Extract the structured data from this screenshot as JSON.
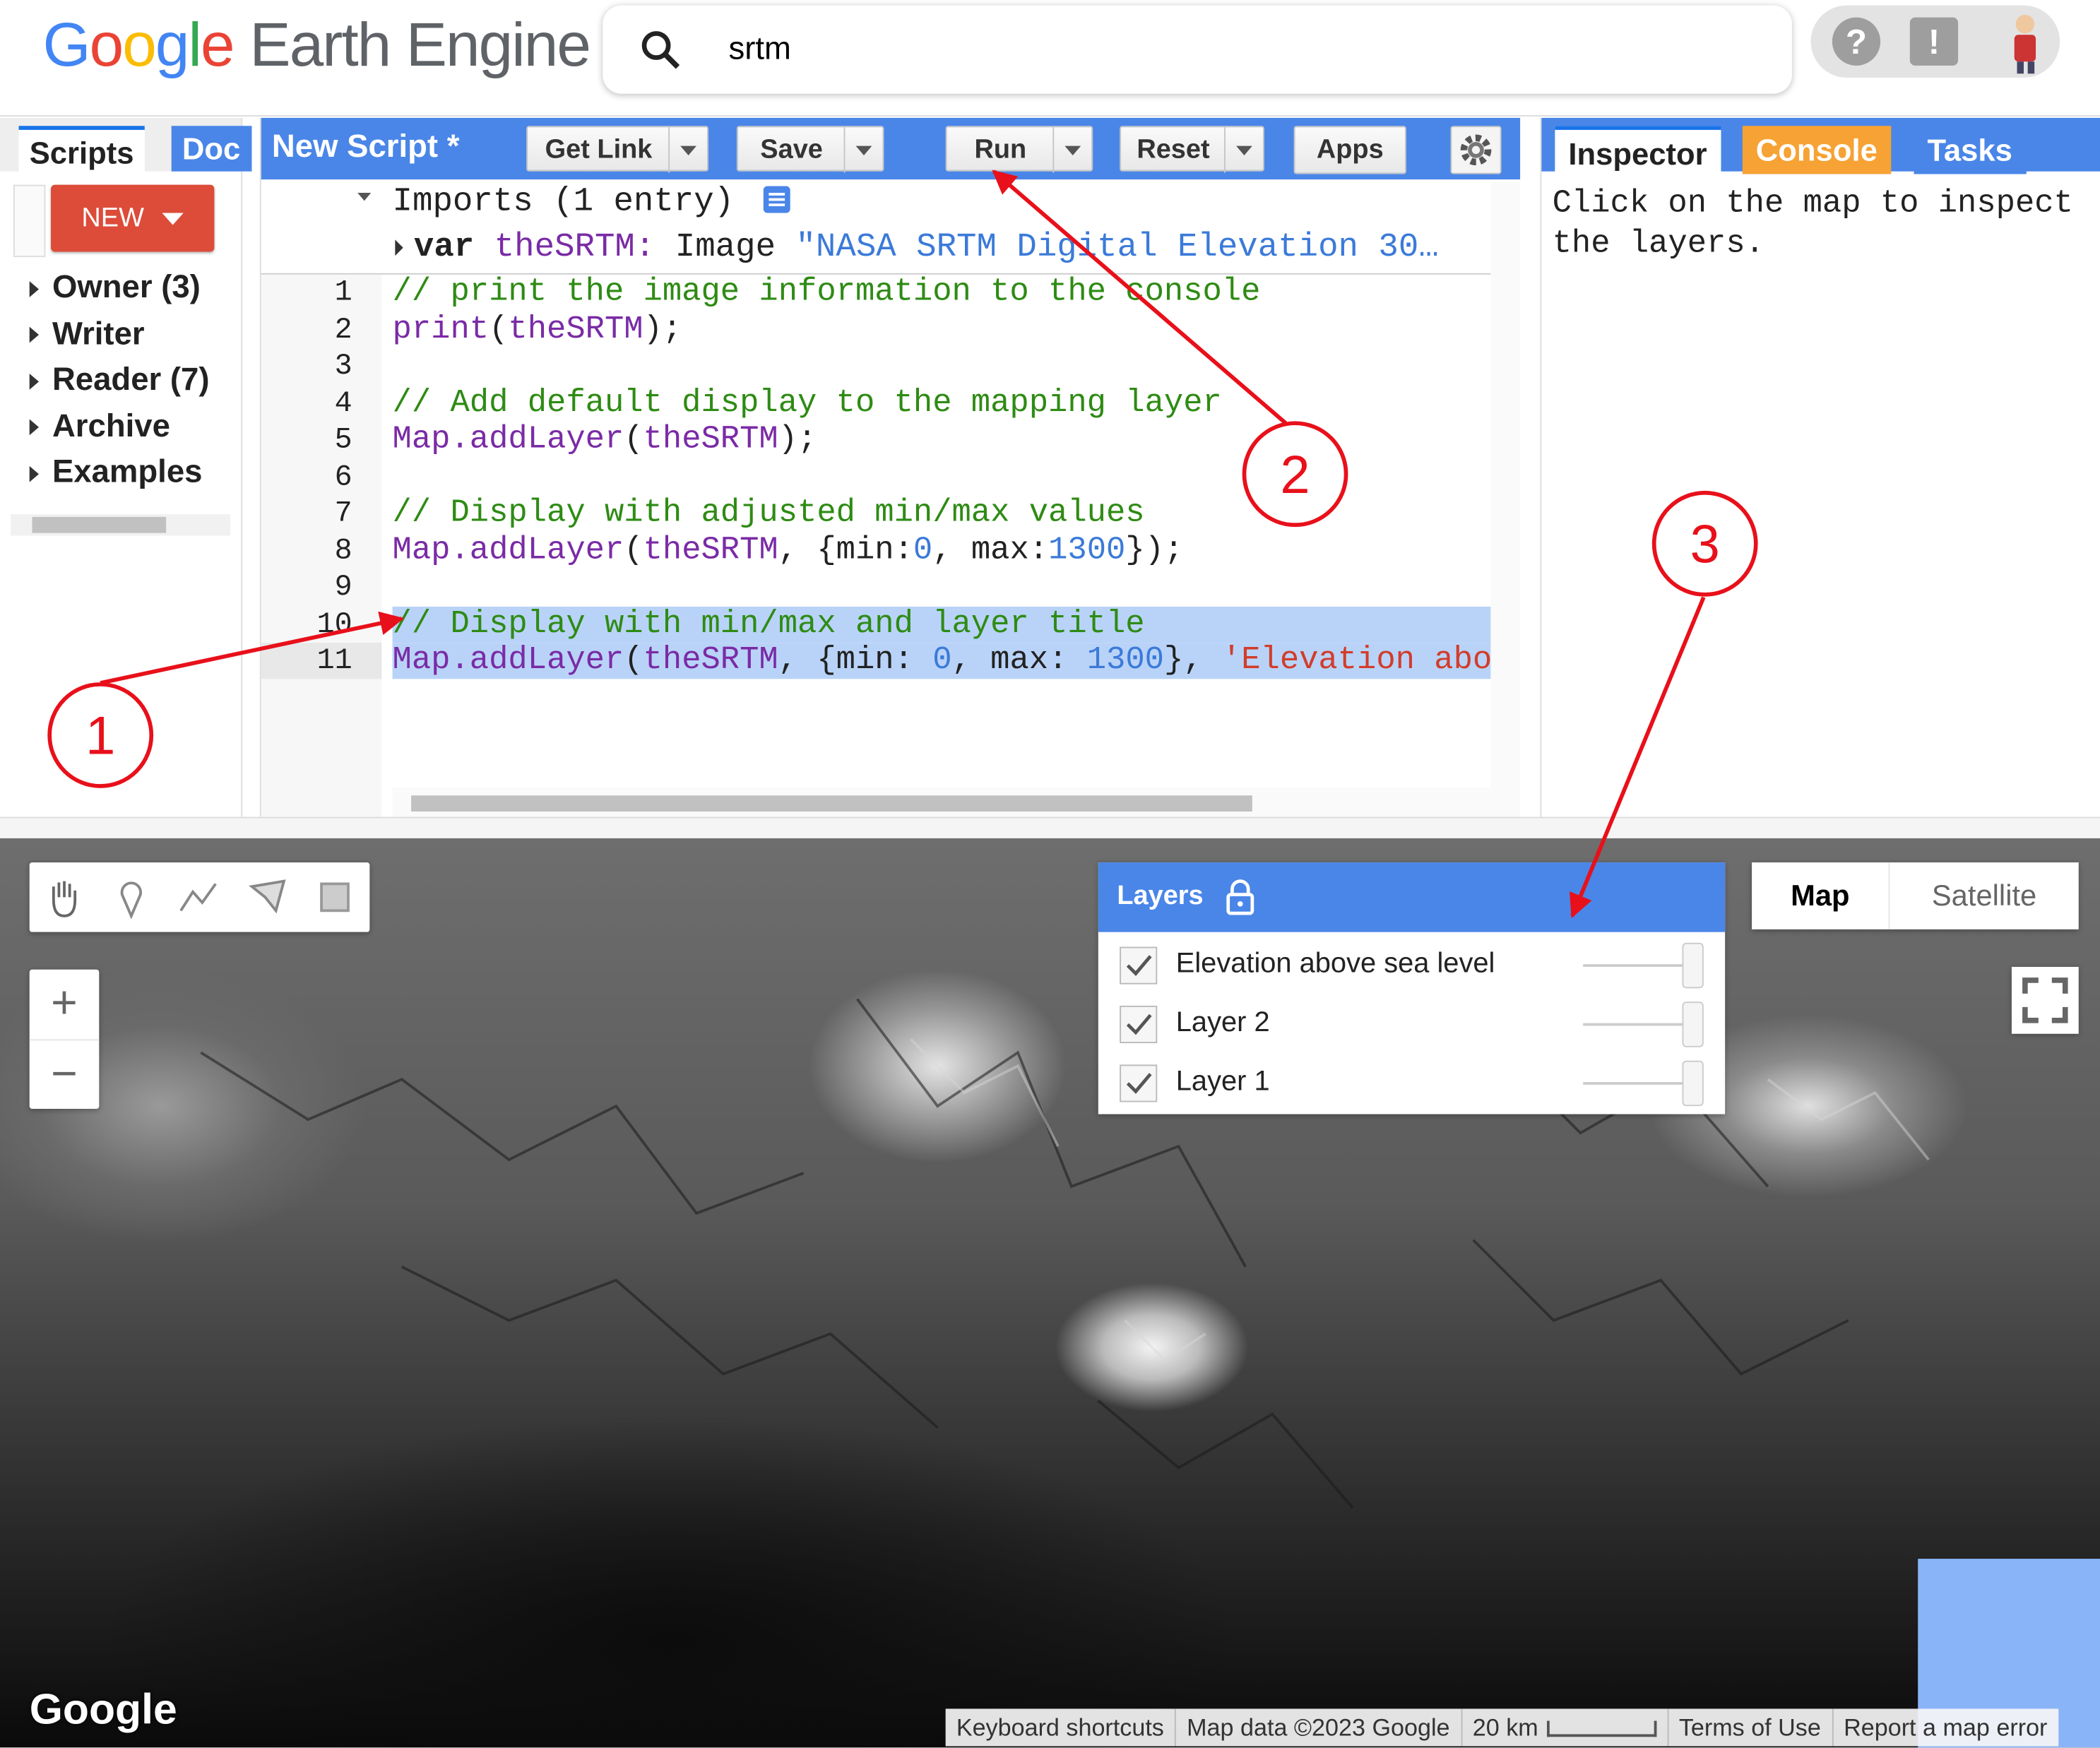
{
  "header": {
    "logo_google": [
      "G",
      "o",
      "o",
      "g",
      "l",
      "e"
    ],
    "logo_product": "Earth Engine",
    "search_value": "srtm",
    "help_icon": "?",
    "feedback_icon": "!"
  },
  "left_panel": {
    "tabs": [
      {
        "label": "Scripts"
      },
      {
        "label": "Doc"
      }
    ],
    "new_button": "NEW",
    "tree": [
      {
        "label": "Owner (3)"
      },
      {
        "label": "Writer"
      },
      {
        "label": "Reader (7)"
      },
      {
        "label": "Archive"
      },
      {
        "label": "Examples"
      }
    ]
  },
  "editor": {
    "title": "New Script *",
    "buttons": {
      "get_link": "Get Link",
      "save": "Save",
      "run": "Run",
      "reset": "Reset",
      "apps": "Apps"
    },
    "imports": {
      "header": "Imports (1 entry)",
      "var_keyword": "var",
      "var_name": "theSRTM:",
      "var_type": "Image",
      "var_value": "\"NASA SRTM Digital Elevation 30…"
    },
    "line_numbers": [
      "1",
      "2",
      "3",
      "4",
      "5",
      "6",
      "7",
      "8",
      "9",
      "10",
      "11"
    ],
    "lines": {
      "l1": "// print the image information to the console",
      "l2_fn": "print",
      "l2_open": "(",
      "l2_arg": "theSRTM",
      "l2_close": ");",
      "l4": "// Add default display to the mapping layer",
      "l5_fn": "Map.addLayer",
      "l5_open": "(",
      "l5_arg": "theSRTM",
      "l5_close": ");",
      "l7": "// Display with adjusted min/max values",
      "l8_fn": "Map.addLayer",
      "l8_open": "(",
      "l8_arg": "theSRTM",
      "l8_mid": ", {min:",
      "l8_min": "0",
      "l8_mid2": ", max:",
      "l8_max": "1300",
      "l8_close": "});",
      "l10": "// Display with min/max and layer title",
      "l11_fn": "Map.addLayer",
      "l11_open": "(",
      "l11_arg": "theSRTM",
      "l11_mid": ", {min: ",
      "l11_min": "0",
      "l11_mid2": ", max: ",
      "l11_max": "1300",
      "l11_close": "}, ",
      "l11_str": "'Elevation abov"
    }
  },
  "right_panel": {
    "tabs": [
      {
        "label": "Inspector"
      },
      {
        "label": "Console"
      },
      {
        "label": "Tasks"
      }
    ],
    "inspector_text": "Click on the map to inspect\nthe layers."
  },
  "map": {
    "zoom_in": "+",
    "zoom_out": "−",
    "layers_title": "Layers",
    "layers": [
      {
        "name": "Elevation above sea level",
        "checked": true
      },
      {
        "name": "Layer 2",
        "checked": true
      },
      {
        "name": "Layer 1",
        "checked": true
      }
    ],
    "map_types": {
      "map": "Map",
      "satellite": "Satellite"
    },
    "google_logo": "Google",
    "footer": {
      "shortcuts": "Keyboard shortcuts",
      "map_data": "Map data ©2023 Google",
      "scale": "20 km",
      "terms": "Terms of Use",
      "report": "Report a map error"
    }
  },
  "annotations": {
    "marker_1": "1",
    "marker_2": "2",
    "marker_3": "3",
    "color": "#e8101a"
  },
  "colors": {
    "accent_blue": "#4a86e8",
    "console_orange": "#f6a234",
    "new_red": "#dd4b39"
  }
}
